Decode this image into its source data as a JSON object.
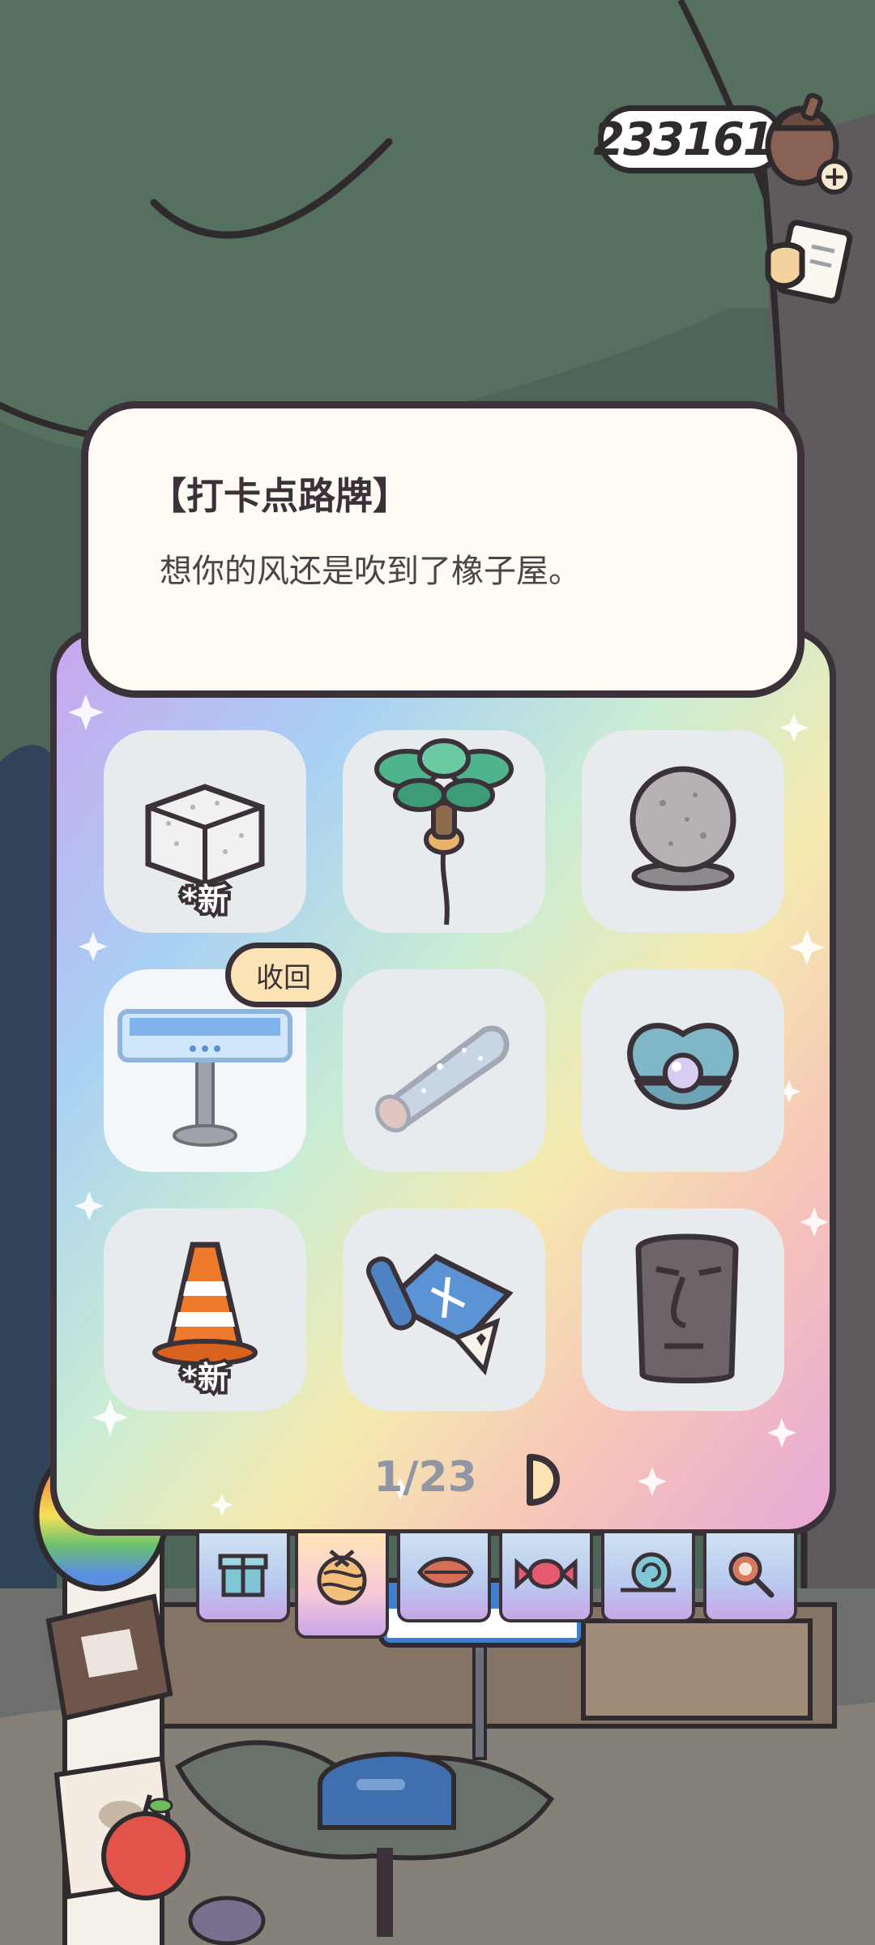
{
  "hud": {
    "acorn_count": "233161"
  },
  "dialog": {
    "title": "【打卡点路牌】",
    "description": "想你的风还是吹到了橡子屋。"
  },
  "inventory": {
    "items": [
      {
        "name": "stone-block",
        "badge": "*新"
      },
      {
        "name": "palm-balloon",
        "badge": ""
      },
      {
        "name": "stone-sphere",
        "badge": ""
      },
      {
        "name": "checkpoint-signpost",
        "badge": "",
        "action": "收回"
      },
      {
        "name": "glitter-log",
        "badge": ""
      },
      {
        "name": "pearl-shell",
        "badge": ""
      },
      {
        "name": "traffic-cone",
        "badge": "*新"
      },
      {
        "name": "map-scroll",
        "badge": ""
      },
      {
        "name": "moai-head",
        "badge": ""
      }
    ],
    "page_indicator": "1/23"
  },
  "tabs": [
    {
      "name": "gift",
      "icon": "gift-icon",
      "active": false
    },
    {
      "name": "yarn",
      "icon": "yarn-ball-icon",
      "active": true
    },
    {
      "name": "leaf",
      "icon": "leaf-icon",
      "active": false
    },
    {
      "name": "candy",
      "icon": "candy-icon",
      "active": false
    },
    {
      "name": "snail",
      "icon": "snail-icon",
      "active": false
    },
    {
      "name": "search",
      "icon": "magnifier-icon",
      "active": false
    }
  ],
  "colors": {
    "background_green": "#4e6659",
    "panel_white": "#fffaf4",
    "outline": "#3a3238",
    "tile_gray": "#e7ebee",
    "recall_button": "#fbe3b5"
  }
}
